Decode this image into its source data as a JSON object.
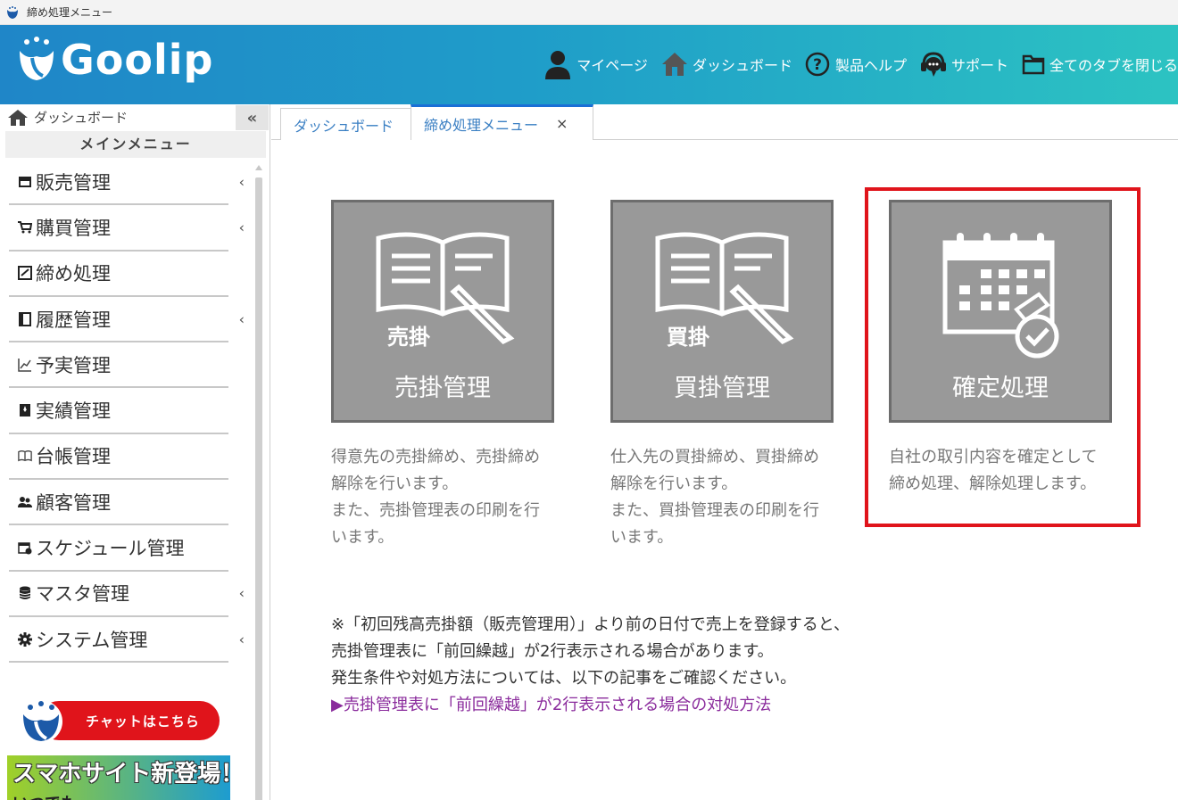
{
  "window": {
    "title": "締め処理メニュー"
  },
  "header": {
    "logo_text": "Goolip",
    "nav": [
      {
        "label": "マイページ",
        "icon": "user-icon"
      },
      {
        "label": "ダッシュボード",
        "icon": "home-icon"
      },
      {
        "label": "製品ヘルプ",
        "icon": "help-icon"
      },
      {
        "label": "サポート",
        "icon": "headset-icon"
      },
      {
        "label": "全てのタブを閉じる",
        "icon": "folder-icon"
      }
    ]
  },
  "sidebar": {
    "dashboard_label": "ダッシュボード",
    "collapse_label": "«",
    "main_menu_title": "メインメニュー",
    "items": [
      {
        "label": "販売管理",
        "icon": "store-icon",
        "arrow": "‹"
      },
      {
        "label": "購買管理",
        "icon": "cart-icon",
        "arrow": "‹"
      },
      {
        "label": "締め処理",
        "icon": "checkbox-icon",
        "arrow": ""
      },
      {
        "label": "履歴管理",
        "icon": "history-icon",
        "arrow": "‹"
      },
      {
        "label": "予実管理",
        "icon": "chart-icon",
        "arrow": ""
      },
      {
        "label": "実績管理",
        "icon": "bookmark-icon",
        "arrow": ""
      },
      {
        "label": "台帳管理",
        "icon": "book-icon",
        "arrow": ""
      },
      {
        "label": "顧客管理",
        "icon": "users-icon",
        "arrow": ""
      },
      {
        "label": "スケジュール管理",
        "icon": "calendar-icon",
        "arrow": ""
      },
      {
        "label": "マスタ管理",
        "icon": "database-icon",
        "arrow": "‹"
      },
      {
        "label": "システム管理",
        "icon": "gear-icon",
        "arrow": "‹"
      }
    ],
    "chat_label": "チャットはこちら",
    "smartphone_title": "スマホサイト新登場！",
    "smartphone_sub": "いつでも"
  },
  "tabs": [
    {
      "label": "ダッシュボード"
    },
    {
      "label": "締め処理メニュー",
      "close": "×"
    }
  ],
  "cards": [
    {
      "title": "売掛管理",
      "badge": "売掛",
      "icon": "book-pen-icon",
      "desc": [
        "得意先の売掛締め、売掛締め",
        "解除を行います。",
        "また、売掛管理表の印刷を行",
        "います。"
      ]
    },
    {
      "title": "買掛管理",
      "badge": "買掛",
      "icon": "book-pen-icon",
      "desc": [
        "仕入先の買掛締め、買掛締め",
        "解除を行います。",
        "また、買掛管理表の印刷を行",
        "います。"
      ]
    },
    {
      "title": "確定処理",
      "badge": "",
      "icon": "calendar-check-icon",
      "desc": [
        "自社の取引内容を確定として",
        "締め処理、解除処理します。"
      ]
    }
  ],
  "note": {
    "lines": [
      "※「初回残高売掛額（販売管理用）」より前の日付で売上を登録すると、",
      "売掛管理表に「前回繰越」が2行表示される場合があります。",
      "発生条件や対処方法については、以下の記事をご確認ください。"
    ],
    "link": "▶売掛管理表に「前回繰越」が2行表示される場合の対処方法"
  },
  "colors": {
    "header_start": "#1f86c8",
    "header_end": "#2cc3c2",
    "highlight": "#e0141b",
    "card_bg": "#999999",
    "link": "#8a2b9c"
  }
}
